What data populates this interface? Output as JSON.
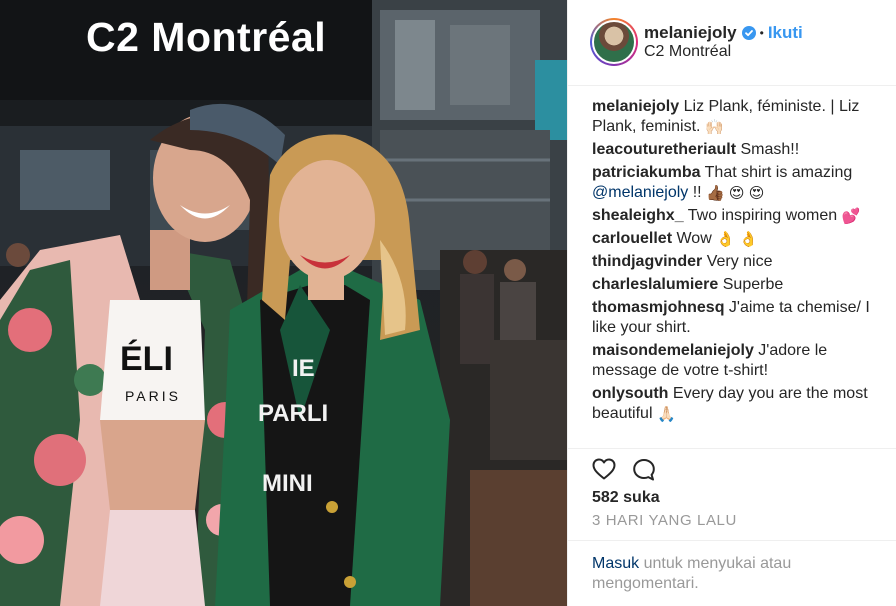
{
  "photo": {
    "sign_text": "C2 Montréal",
    "shirt_left_lines": [
      "ÉLI",
      "PARIS"
    ],
    "shirt_right_lines": [
      "IE",
      "PARLI",
      "MINI"
    ]
  },
  "post": {
    "username": "melaniejoly",
    "verified_icon": "verified-badge-icon",
    "separator": "•",
    "follow_label": "Ikuti",
    "location": "C2 Montréal"
  },
  "comments": [
    {
      "user": "melaniejoly",
      "text": "Liz Plank, féministe. | Liz Plank, feminist.",
      "emoji": "🙌🏻"
    },
    {
      "user": "leacouturetheriault",
      "text": "Smash!!",
      "emoji": ""
    },
    {
      "user": "patriciakumba",
      "text": "That shirt is amazing",
      "mention": "@melaniejoly",
      "after": "!!",
      "emoji": "👍🏾 😍 😍"
    },
    {
      "user": "shealeighx_",
      "text": "Two inspiring women",
      "emoji": "💕"
    },
    {
      "user": "carlouellet",
      "text": "Wow",
      "emoji": "👌 👌"
    },
    {
      "user": "thindjagvinder",
      "text": "Very nice",
      "emoji": ""
    },
    {
      "user": "charleslalumiere",
      "text": "Superbe",
      "emoji": ""
    },
    {
      "user": "thomasmjohnesq",
      "text": "J'aime ta chemise/ I like your shirt.",
      "emoji": ""
    },
    {
      "user": "maisondemelaniejoly",
      "text": "J'adore le message de votre t-shirt!",
      "emoji": ""
    },
    {
      "user": "onlysouth",
      "text": "Every day you are the most beautiful",
      "emoji": "🙏🏻"
    }
  ],
  "actions": {
    "like_icon": "heart-icon",
    "comment_icon": "comment-bubble-icon"
  },
  "likes_text": "582 suka",
  "timestamp": "3 HARI YANG LALU",
  "login": {
    "link_label": "Masuk",
    "rest_text": " untuk menyukai atau mengomentari."
  },
  "colors": {
    "accent_blue": "#3897f0",
    "link_dark": "#003569",
    "muted": "#999999"
  }
}
